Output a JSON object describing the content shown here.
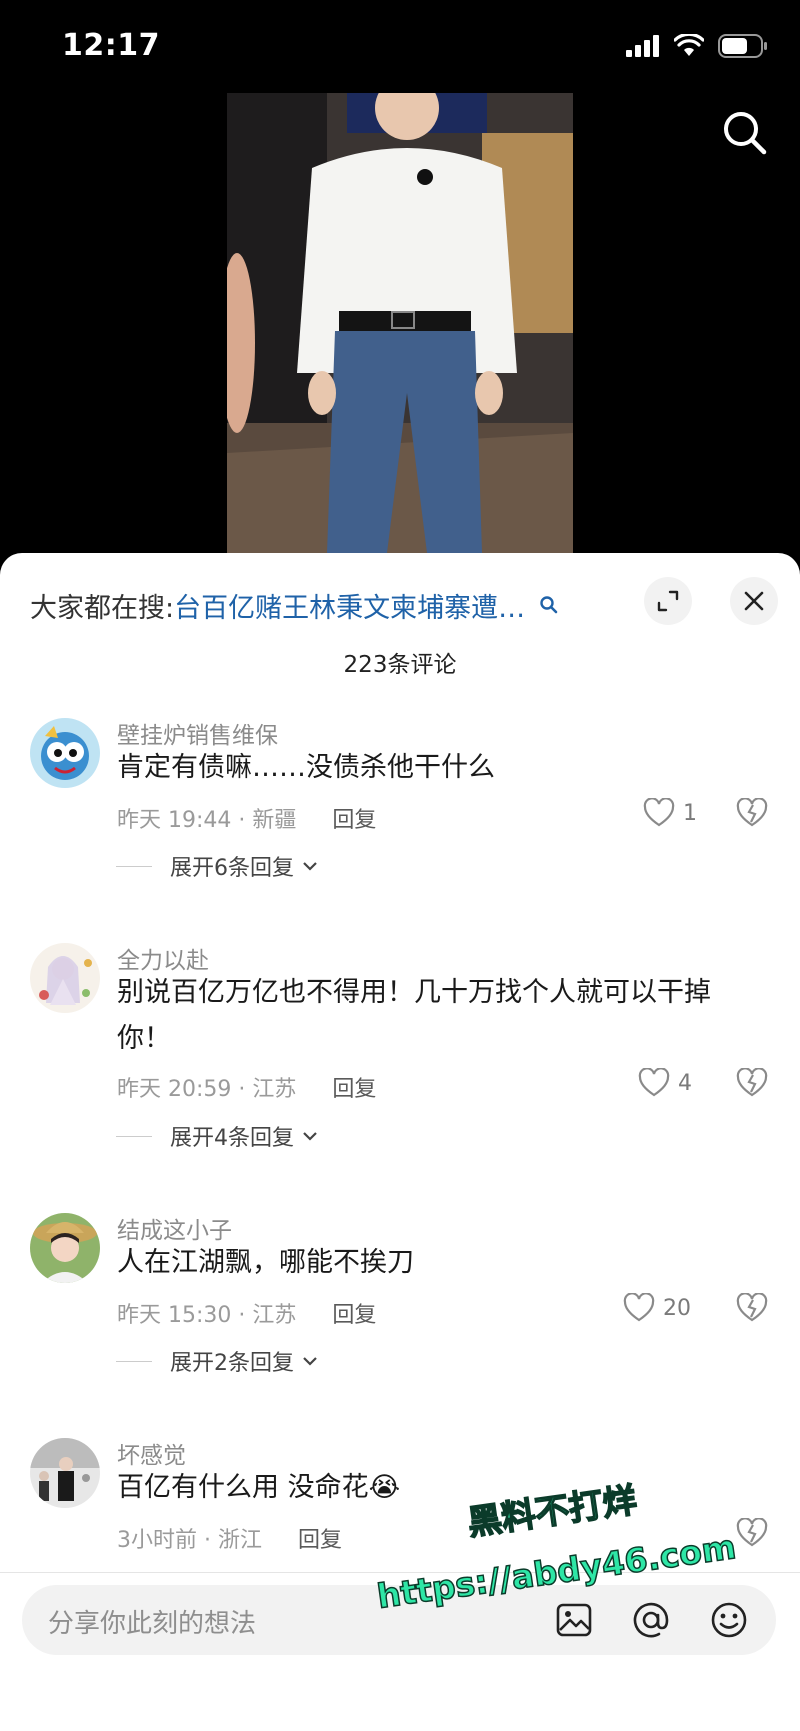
{
  "status_bar": {
    "time": "12:17"
  },
  "search_bar": {
    "prefix": "大家都在搜:",
    "query": "台百亿赌王林秉文柬埔寨遭…"
  },
  "comments_count": "223条评论",
  "comments": [
    {
      "username": "壁挂炉销售维保",
      "text": "肯定有债嘛……没债杀他干什么",
      "time_location": "昨天 19:44 · 新疆",
      "reply": "回复",
      "likes": "1",
      "expand": "展开6条回复"
    },
    {
      "username": "全力以赴",
      "text": "别说百亿万亿也不得用！几十万找个人就可以干掉你！",
      "time_location": "昨天 20:59 · 江苏",
      "reply": "回复",
      "likes": "4",
      "expand": "展开4条回复"
    },
    {
      "username": "结成这小子",
      "text": "人在江湖飘，哪能不挨刀",
      "time_location": "昨天 15:30 · 江苏",
      "reply": "回复",
      "likes": "20",
      "expand": "展开2条回复"
    },
    {
      "username": "坏感觉",
      "text": "百亿有什么用 没命花😭",
      "time_location": "3小时前 · 浙江",
      "reply": "回复"
    }
  ],
  "input": {
    "placeholder": "分享你此刻的想法"
  },
  "watermark": {
    "line1": "黑料不打烊",
    "line2": "https://abdy46.com"
  },
  "colors": {
    "link": "#1f62a8",
    "watermark": "#2ee6a6"
  }
}
